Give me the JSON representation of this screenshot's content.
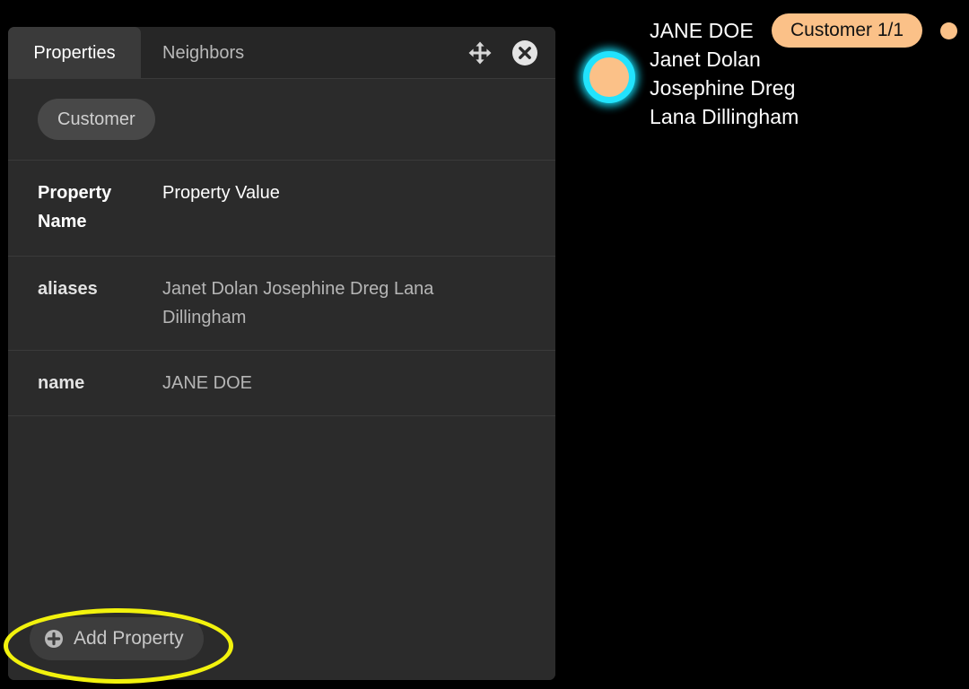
{
  "panel": {
    "tabs": [
      {
        "label": "Properties",
        "active": true
      },
      {
        "label": "Neighbors",
        "active": false
      }
    ],
    "actions": {
      "move_label": "move",
      "close_label": "close"
    },
    "label_chip": "Customer",
    "table": {
      "headers": {
        "name": "Property Name",
        "value": "Property Value"
      },
      "rows": [
        {
          "name": "aliases",
          "value": "Janet Dolan Josephine Dreg Lana Dillingham"
        },
        {
          "name": "name",
          "value": "JANE DOE"
        }
      ]
    },
    "footer": {
      "add_property_label": "Add Property"
    }
  },
  "graph": {
    "node": {
      "labels": [
        "JANE DOE",
        "Janet Dolan",
        "Josephine Dreg",
        "Lana Dillingham"
      ],
      "type_badge": "Customer 1/1",
      "node_fill_color": "#fbc188",
      "node_ring_color": "#22e3fd",
      "badge_color": "#fbc188"
    }
  },
  "annotation": {
    "highlight_color": "#f2f20d",
    "highlight_target": "Add Property"
  }
}
